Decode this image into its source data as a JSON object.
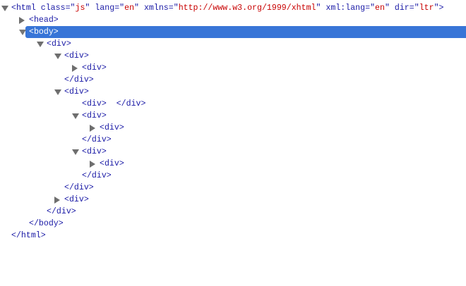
{
  "tree": [
    {
      "depth": 0,
      "arrow": "expanded",
      "open": "html",
      "attrs": [
        {
          "name": "class",
          "value": "js"
        },
        {
          "name": "lang",
          "value": "en"
        },
        {
          "name": "xmlns",
          "value": "http://www.w3.org/1999/xhtml"
        },
        {
          "name": "xml:lang",
          "value": "en"
        },
        {
          "name": "dir",
          "value": "ltr"
        }
      ]
    },
    {
      "depth": 1,
      "arrow": "collapsed",
      "text": "<head>"
    },
    {
      "depth": 1,
      "arrow": "expanded",
      "text": "<body>",
      "selected": true
    },
    {
      "depth": 2,
      "arrow": "expanded",
      "text": "<div>"
    },
    {
      "depth": 3,
      "arrow": "expanded",
      "text": "<div>"
    },
    {
      "depth": 4,
      "arrow": "collapsed",
      "text": "<div>"
    },
    {
      "depth": 3,
      "arrow": "none",
      "text": "</div>"
    },
    {
      "depth": 3,
      "arrow": "expanded",
      "text": "<div>"
    },
    {
      "depth": 4,
      "arrow": "none",
      "text": "<div>  </div>"
    },
    {
      "depth": 4,
      "arrow": "expanded",
      "text": "<div>"
    },
    {
      "depth": 5,
      "arrow": "collapsed",
      "text": "<div>"
    },
    {
      "depth": 4,
      "arrow": "none",
      "text": "</div>"
    },
    {
      "depth": 4,
      "arrow": "expanded",
      "text": "<div>"
    },
    {
      "depth": 5,
      "arrow": "collapsed",
      "text": "<div>"
    },
    {
      "depth": 4,
      "arrow": "none",
      "text": "</div>"
    },
    {
      "depth": 3,
      "arrow": "none",
      "text": "</div>"
    },
    {
      "depth": 3,
      "arrow": "collapsed",
      "text": "<div>"
    },
    {
      "depth": 2,
      "arrow": "none",
      "text": "</div>"
    },
    {
      "depth": 1,
      "arrow": "none",
      "text": "</body>"
    },
    {
      "depth": 0,
      "arrow": "none",
      "text": "</html>"
    }
  ],
  "colors": {
    "selection": "#3875d7",
    "tag": "#1a1aa6",
    "attr_value": "#c80000"
  }
}
